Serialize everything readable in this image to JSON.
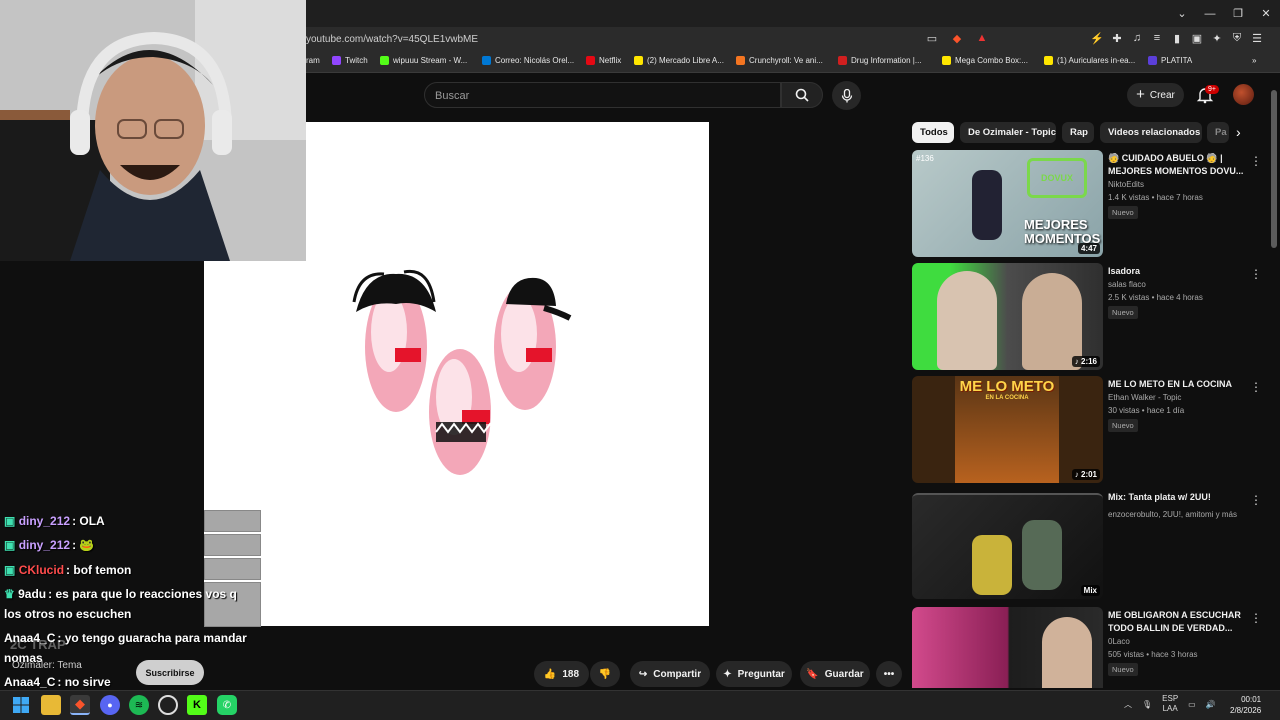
{
  "browser": {
    "url": "youtube.com/watch?v=45QLE1vwbME",
    "bookmarks": [
      {
        "label": "ram",
        "color": "#555555"
      },
      {
        "label": "Twitch",
        "color": "#9146ff"
      },
      {
        "label": "wipuuu Stream - W...",
        "color": "#53fc18"
      },
      {
        "label": "Correo: Nicolás Orel...",
        "color": "#0078d4"
      },
      {
        "label": "Netflix",
        "color": "#e50914"
      },
      {
        "label": "(2) Mercado Libre A...",
        "color": "#ffe600"
      },
      {
        "label": "Crunchyroll: Ve ani...",
        "color": "#f47521"
      },
      {
        "label": "Drug Information |...",
        "color": "#d11f1f"
      },
      {
        "label": "Mega Combo Box:...",
        "color": "#ffe600"
      },
      {
        "label": "(1) Auriculares in-ea...",
        "color": "#ffe600"
      },
      {
        "label": "PLATITA",
        "color": "#5b3fd9"
      }
    ]
  },
  "youtube": {
    "search_placeholder": "Buscar",
    "create_label": "Crear",
    "notifications_badge": "9+",
    "chips": [
      {
        "label": "Todos",
        "active": true
      },
      {
        "label": "De Ozimaler - Topic",
        "active": false
      },
      {
        "label": "Rap",
        "active": false
      },
      {
        "label": "Videos relacionados",
        "active": false
      },
      {
        "label": "Pa",
        "active": false
      }
    ],
    "actions": {
      "likes": "188",
      "share": "Compartir",
      "ask": "Preguntar",
      "save": "Guardar"
    },
    "recommendations": [
      {
        "title": "🧓 CUIDADO ABUELO 🧓 | MEJORES MOMENTOS DOVU...",
        "channel": "NiktoEdits",
        "meta": "1.4 K vistas • hace 7 horas",
        "badge": "Nuevo",
        "duration": "4:47",
        "thumb_text": "MEJORES MOMENTOS",
        "thumb_tag": "#136"
      },
      {
        "title": "Isadora",
        "channel": "salas flaco",
        "meta": "2.5 K vistas • hace 4 horas",
        "badge": "Nuevo",
        "duration": "♪ 2:16"
      },
      {
        "title": "ME LO METO EN LA COCINA",
        "channel": "Ethan Walker - Topic",
        "meta": "30 vistas • hace 1 día",
        "badge": "Nuevo",
        "duration": "♪ 2:01",
        "thumb_text": "ME LO METO",
        "thumb_sub": "EN LA COCINA"
      },
      {
        "title": "Mix: Tanta plata w/ 2UU!",
        "channel": "enzocerobulto, 2UU!, amitomi y más",
        "meta": "",
        "badge": "",
        "duration": "Mix"
      },
      {
        "title": "ME OBLIGARON A ESCUCHAR TODO BALLIN DE VERDAD...",
        "channel": "0Laco",
        "meta": "505 vistas • hace 3 horas",
        "badge": "Nuevo",
        "duration": ""
      }
    ]
  },
  "chat": {
    "messages": [
      {
        "user": "diny_212",
        "text": ": OLA",
        "color": "#c9a0ff"
      },
      {
        "user": "diny_212",
        "text": ": 🐸",
        "color": "#c9a0ff"
      },
      {
        "user": "CKlucid",
        "text": ": bof temon",
        "color": "#ff4c4c"
      },
      {
        "user": "9adu",
        "text": ": es para que lo reacciones vos q",
        "color": "#ffffff"
      },
      {
        "user": "",
        "text": "los otros no escuchen",
        "color": "#ffffff"
      },
      {
        "user": "Anaa4_C",
        "text": ": yo tengo guaracha para mandar",
        "color": "#ffffff"
      },
      {
        "user": "",
        "text": "nomas",
        "color": "#ffffff"
      },
      {
        "user": "Anaa4_C",
        "text": ": no sirve",
        "color": "#ffffff"
      }
    ],
    "watermark": "2C TRAP",
    "now_playing": "Ozimaler: Tema",
    "subscribe_label": "Suscribirse"
  },
  "system": {
    "lang": "ESP",
    "lang_sub": "LAA",
    "time": "00:01",
    "date": "2/8/2026"
  }
}
